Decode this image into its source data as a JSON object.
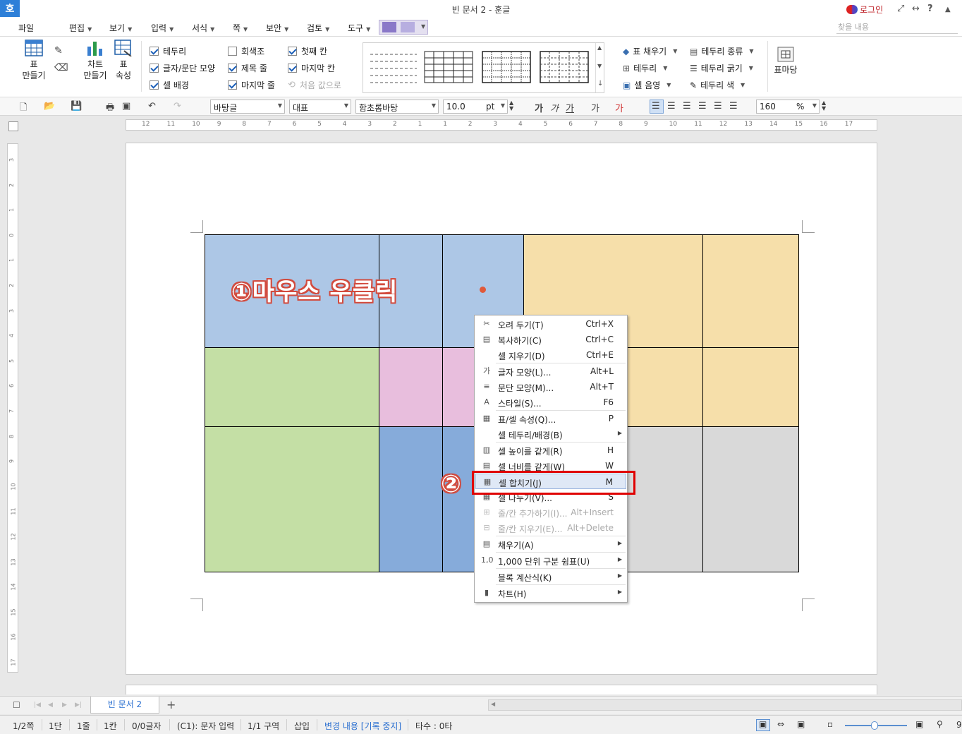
{
  "app": {
    "logo": "호",
    "title": "빈 문서 2 - 훈글",
    "login": "로그인"
  },
  "menu": {
    "items": [
      "파일",
      "편집",
      "보기",
      "입력",
      "서식",
      "쪽",
      "보안",
      "검토",
      "도구"
    ],
    "search_placeholder": "찾을 내용"
  },
  "ribbon": {
    "table_make": [
      "표",
      "만들기"
    ],
    "chart_make": [
      "차트",
      "만들기"
    ],
    "table_props": [
      "표",
      "속성"
    ],
    "checks_col1": [
      {
        "label": "테두리",
        "checked": true
      },
      {
        "label": "글자/문단 모양",
        "checked": true
      },
      {
        "label": "셀 배경",
        "checked": true
      }
    ],
    "checks_col2": [
      {
        "label": "회색조",
        "checked": false
      },
      {
        "label": "제목 줄",
        "checked": true
      },
      {
        "label": "마지막 줄",
        "checked": true
      }
    ],
    "checks_col3": [
      {
        "label": "첫째 칸",
        "checked": true
      },
      {
        "label": "마지막 칸",
        "checked": true
      }
    ],
    "reset_label": "처음 값으로",
    "right_col1": [
      "표 채우기",
      "테두리",
      "셀 음영"
    ],
    "right_col2": [
      "테두리 종류",
      "테두리 굵기",
      "테두리 색"
    ],
    "table_madang": "표마당"
  },
  "format": {
    "style": "바탕글",
    "lang": "대표",
    "font": "함초롬바탕",
    "size": "10.0",
    "unit": "pt",
    "char_buttons": [
      "가",
      "가",
      "가",
      "가",
      "가"
    ],
    "zoom": "160",
    "zoom_unit": "%"
  },
  "ruler": {
    "h_ticks": [
      "12",
      "11",
      "10",
      "9",
      "8",
      "7",
      "6",
      "5",
      "4",
      "3",
      "2",
      "1",
      "1",
      "2",
      "3",
      "4",
      "5",
      "6",
      "7",
      "8",
      "9",
      "10",
      "11",
      "12",
      "13",
      "14",
      "15",
      "16",
      "17"
    ],
    "v_ticks": [
      "3",
      "2",
      "1",
      "0",
      "1",
      "2",
      "3",
      "4",
      "5",
      "6",
      "7",
      "8",
      "9",
      "10",
      "11",
      "12",
      "13",
      "14",
      "15",
      "16",
      "17"
    ]
  },
  "annotations": {
    "step1": "①마우스 우클릭",
    "step2": "②"
  },
  "context_menu": [
    {
      "icon": "scissors-icon",
      "glyph": "✂",
      "label": "오려 두기(T)",
      "shortcut": "Ctrl+X"
    },
    {
      "icon": "copy-icon",
      "glyph": "▤",
      "label": "복사하기(C)",
      "shortcut": "Ctrl+C"
    },
    {
      "icon": "",
      "glyph": "",
      "label": "셀 지우기(D)",
      "shortcut": "Ctrl+E"
    },
    {
      "icon": "char-shape-icon",
      "glyph": "가",
      "label": "글자 모양(L)...",
      "shortcut": "Alt+L"
    },
    {
      "icon": "para-shape-icon",
      "glyph": "≡",
      "label": "문단 모양(M)...",
      "shortcut": "Alt+T"
    },
    {
      "icon": "style-icon",
      "glyph": "A",
      "label": "스타일(S)...",
      "shortcut": "F6"
    },
    {
      "icon": "table-props-icon",
      "glyph": "▦",
      "label": "표/셀 속성(Q)...",
      "shortcut": "P"
    },
    {
      "icon": "",
      "glyph": "",
      "label": "셀 테두리/배경(B)",
      "shortcut": "",
      "submenu": true
    },
    {
      "icon": "same-height-icon",
      "glyph": "▥",
      "label": "셀 높이를 같게(R)",
      "shortcut": "H"
    },
    {
      "icon": "same-width-icon",
      "glyph": "▤",
      "label": "셀 너비를 같게(W)",
      "shortcut": "W"
    },
    {
      "icon": "merge-cells-icon",
      "glyph": "▦",
      "label": "셀 합치기(J)",
      "shortcut": "M"
    },
    {
      "icon": "split-cells-icon",
      "glyph": "▦",
      "label": "셀 나누기(V)...",
      "shortcut": "S"
    },
    {
      "icon": "add-row-col-icon",
      "glyph": "⊞",
      "label": "줄/칸 추가하기(I)...",
      "shortcut": "Alt+Insert",
      "disabled": true
    },
    {
      "icon": "delete-row-col-icon",
      "glyph": "⊟",
      "label": "줄/칸 지우기(E)...",
      "shortcut": "Alt+Delete",
      "disabled": true
    },
    {
      "icon": "fill-icon",
      "glyph": "▤",
      "label": "채우기(A)",
      "shortcut": "",
      "submenu": true
    },
    {
      "icon": "thousands-icon",
      "glyph": "1,0",
      "label": "1,000 단위 구분 쉼표(U)",
      "shortcut": "",
      "submenu": true
    },
    {
      "icon": "",
      "glyph": "",
      "label": "블록 계산식(K)",
      "shortcut": "",
      "submenu": true
    },
    {
      "icon": "chart-icon",
      "glyph": "▮",
      "label": "차트(H)",
      "shortcut": "",
      "submenu": true
    }
  ],
  "tabs": {
    "doc_tab": "빈 문서 2",
    "add": "+"
  },
  "status": {
    "page": "1/2쪽",
    "column": "1단",
    "line": "1줄",
    "col": "1칸",
    "chars": "0/0글자",
    "cell": "(C1): 문자 입력",
    "section": "1/1 구역",
    "mode": "삽입",
    "track": "변경 내용 [기록 중지]",
    "typing": "타수 : 0타"
  },
  "colors": {
    "accent": "#2a6fd0",
    "blue_cell": "#adc7e6",
    "orange_cell": "#f6dfaa",
    "green_cell": "#c4dfa5",
    "pink_cell": "#e8bedd",
    "mid_blue_cell": "#86abda",
    "grey_cell": "#d9d9d9",
    "highlight_box": "#e00000"
  }
}
